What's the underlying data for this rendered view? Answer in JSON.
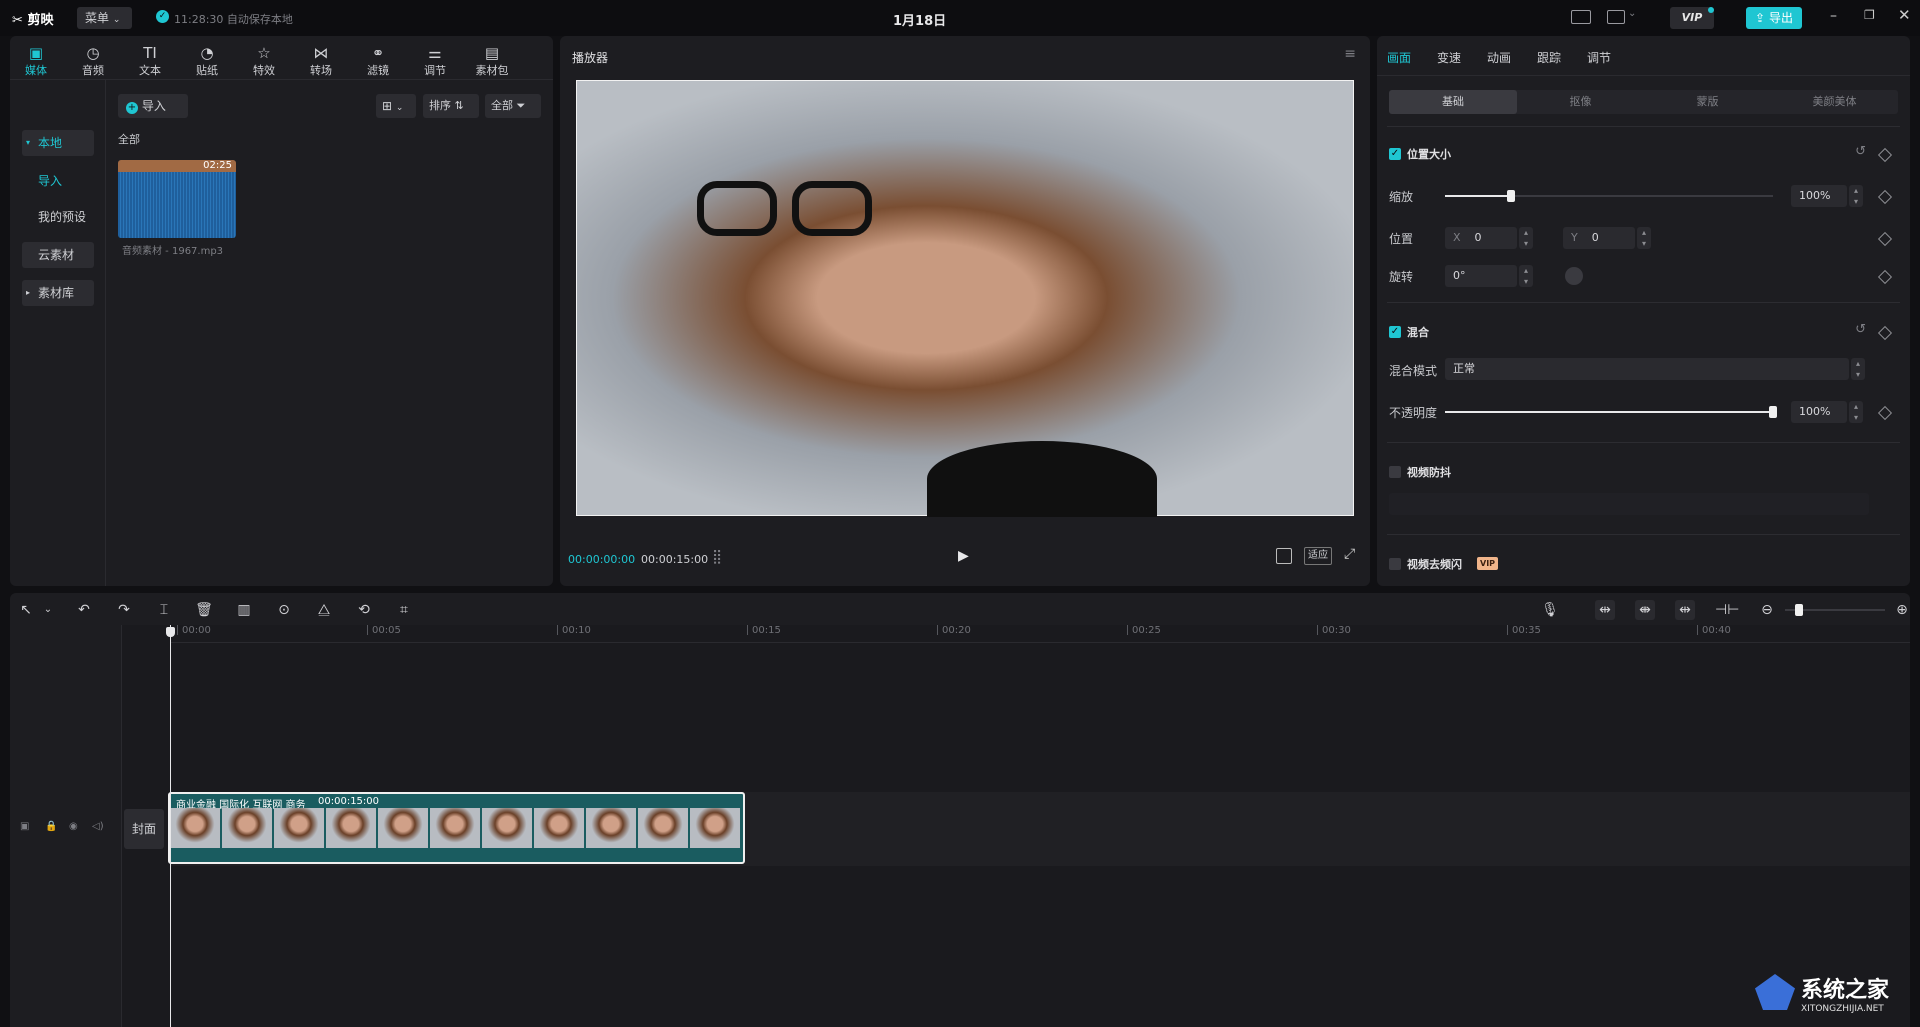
{
  "app": {
    "logo": "剪映",
    "menu": "菜单",
    "autosave": "11:28:30 自动保存本地",
    "title": "1月18日",
    "vip": "VIP",
    "export": "导出"
  },
  "media_panel": {
    "tabs": [
      {
        "label": "媒体",
        "icon": "media-icon"
      },
      {
        "label": "音频",
        "icon": "audio-icon"
      },
      {
        "label": "文本",
        "icon": "text-icon"
      },
      {
        "label": "贴纸",
        "icon": "sticker-icon"
      },
      {
        "label": "特效",
        "icon": "effects-icon"
      },
      {
        "label": "转场",
        "icon": "transition-icon"
      },
      {
        "label": "滤镜",
        "icon": "filter-icon"
      },
      {
        "label": "调节",
        "icon": "adjust-icon"
      },
      {
        "label": "素材包",
        "icon": "package-icon"
      }
    ],
    "side": {
      "local": "本地",
      "import": "导入",
      "presets": "我的预设",
      "cloud": "云素材",
      "library": "素材库"
    },
    "import_btn": "导入",
    "sort": "排序",
    "filter": "全部",
    "section": "全部",
    "asset": {
      "duration": "02:25",
      "name": "音频素材 - 1967.mp3"
    }
  },
  "player": {
    "title": "播放器",
    "current": "00:00:00:00",
    "total": "00:00:15:00",
    "fit": "适应"
  },
  "inspector": {
    "tabs": [
      "画面",
      "变速",
      "动画",
      "跟踪",
      "调节"
    ],
    "subtabs": [
      "基础",
      "抠像",
      "蒙版",
      "美颜美体"
    ],
    "position_size": {
      "title": "位置大小",
      "scale_label": "缩放",
      "scale_value": "100%",
      "scale": 0.2,
      "pos_label": "位置",
      "x_label": "X",
      "x": "0",
      "y_label": "Y",
      "y": "0",
      "rotate_label": "旋转",
      "rotate": "0°"
    },
    "blend": {
      "title": "混合",
      "mode_label": "混合模式",
      "mode": "正常",
      "opacity_label": "不透明度",
      "opacity_value": "100%",
      "opacity": 1.0
    },
    "stabilize": "视频防抖",
    "deflicker": "视频去频闪",
    "deflicker_badge": "VIP"
  },
  "timeline": {
    "ticks": [
      "00:00",
      "00:05",
      "00:10",
      "00:15",
      "00:20",
      "00:25",
      "00:30",
      "00:35",
      "00:40"
    ],
    "cover": "封面",
    "clip": {
      "title": "商业金融 国际化 互联网 商务",
      "duration": "00:00:15:00"
    }
  },
  "watermark": {
    "text": "系统之家",
    "url": "XITONGZHIJIA.NET"
  },
  "colors": {
    "accent": "#1fc6d2",
    "clip": "#1a5c60",
    "panel": "#1d1d21"
  }
}
